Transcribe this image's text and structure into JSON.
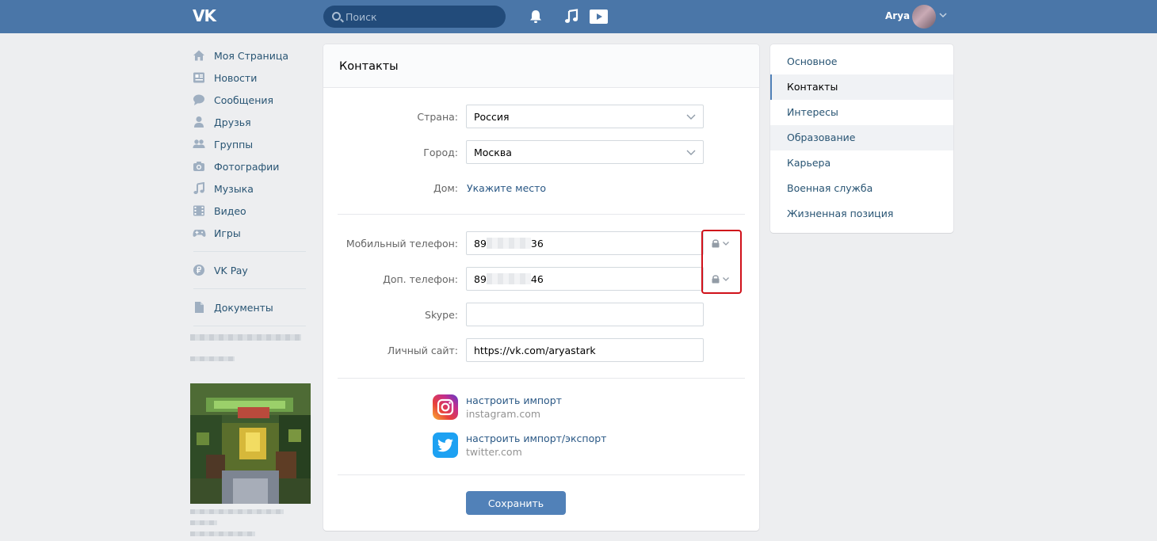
{
  "header": {
    "logo": "VK",
    "search_placeholder": "Поиск",
    "user_name": "Arya"
  },
  "nav": {
    "items": [
      {
        "label": "Моя Страница",
        "icon": "home-icon"
      },
      {
        "label": "Новости",
        "icon": "news-icon"
      },
      {
        "label": "Сообщения",
        "icon": "messages-icon"
      },
      {
        "label": "Друзья",
        "icon": "friends-icon"
      },
      {
        "label": "Группы",
        "icon": "groups-icon"
      },
      {
        "label": "Фотографии",
        "icon": "camera-icon"
      },
      {
        "label": "Музыка",
        "icon": "music-icon"
      },
      {
        "label": "Видео",
        "icon": "video-icon"
      },
      {
        "label": "Игры",
        "icon": "gamepad-icon"
      }
    ],
    "vkpay": {
      "label": "VK Pay",
      "icon": "ruble-icon"
    },
    "documents": {
      "label": "Документы",
      "icon": "document-icon"
    }
  },
  "main": {
    "title": "Контакты",
    "country": {
      "label": "Страна:",
      "value": "Россия"
    },
    "city": {
      "label": "Город:",
      "value": "Москва"
    },
    "home": {
      "label": "Дом:",
      "value": "Укажите место"
    },
    "mobile": {
      "label": "Мобильный телефон:",
      "prefix": "89",
      "suffix": "36"
    },
    "extra_phone": {
      "label": "Доп. телефон:",
      "prefix": "89",
      "suffix": "46"
    },
    "skype": {
      "label": "Skype:",
      "value": ""
    },
    "site": {
      "label": "Личный сайт:",
      "value": "https://vk.com/aryastark"
    },
    "instagram": {
      "action": "настроить импорт",
      "domain": "instagram.com"
    },
    "twitter": {
      "action": "настроить импорт/экспорт",
      "domain": "twitter.com"
    },
    "save_label": "Сохранить"
  },
  "right_menu": {
    "items": [
      {
        "label": "Основное",
        "state": "normal"
      },
      {
        "label": "Контакты",
        "state": "active"
      },
      {
        "label": "Интересы",
        "state": "normal"
      },
      {
        "label": "Образование",
        "state": "hover"
      },
      {
        "label": "Карьера",
        "state": "normal"
      },
      {
        "label": "Военная служба",
        "state": "normal"
      },
      {
        "label": "Жизненная позиция",
        "state": "normal"
      }
    ]
  },
  "colors": {
    "header": "#4a76a8",
    "link": "#2a5885",
    "button": "#5181b8",
    "highlight_box": "#d0111a"
  }
}
